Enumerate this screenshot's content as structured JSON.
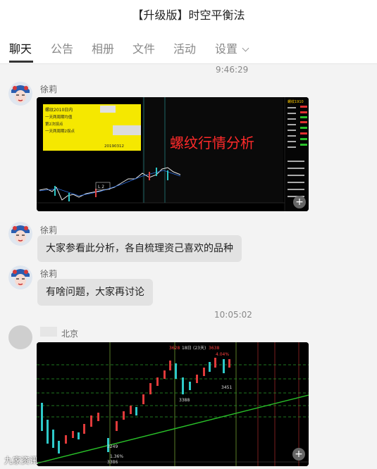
{
  "window": {
    "title": "【升级版】时空平衡法"
  },
  "tabs": [
    {
      "label": "聊天"
    },
    {
      "label": "公告"
    },
    {
      "label": "相册"
    },
    {
      "label": "文件"
    },
    {
      "label": "活动"
    },
    {
      "label": "设置"
    }
  ],
  "messages": {
    "time1": "9:46:29",
    "time2": "10:05:02",
    "m1": {
      "sender": "徐莉",
      "image": {
        "note_title": "螺纹2010日内",
        "note_lines": [
          "一天两周期均值",
          "第2次拐点",
          "一天两周期2拐点"
        ],
        "note_date": "20190312",
        "overlay_text": "螺纹行情分析",
        "tag": "L 2",
        "right_header": "螺纹1910"
      }
    },
    "m2": {
      "sender": "徐莉",
      "text": "大家参看此分析，各自梳理资己喜欢的品种"
    },
    "m3": {
      "sender": "徐莉",
      "text": "有啥问题，大家再讨论"
    },
    "m4": {
      "sender": "北京",
      "image": {
        "top_labels": [
          "3628",
          "18日",
          "(23天)",
          "3638"
        ],
        "pct": "4.04%",
        "low_labels": [
          "3388",
          "3451"
        ],
        "bottom_labels": [
          "3249",
          "1.36%",
          "3386"
        ]
      }
    }
  },
  "watermark": "九家资讯",
  "colors": {
    "bubble": "#e2e2e2",
    "overlay_text": "#ff2a2a",
    "note_bg": "#f5e800"
  }
}
